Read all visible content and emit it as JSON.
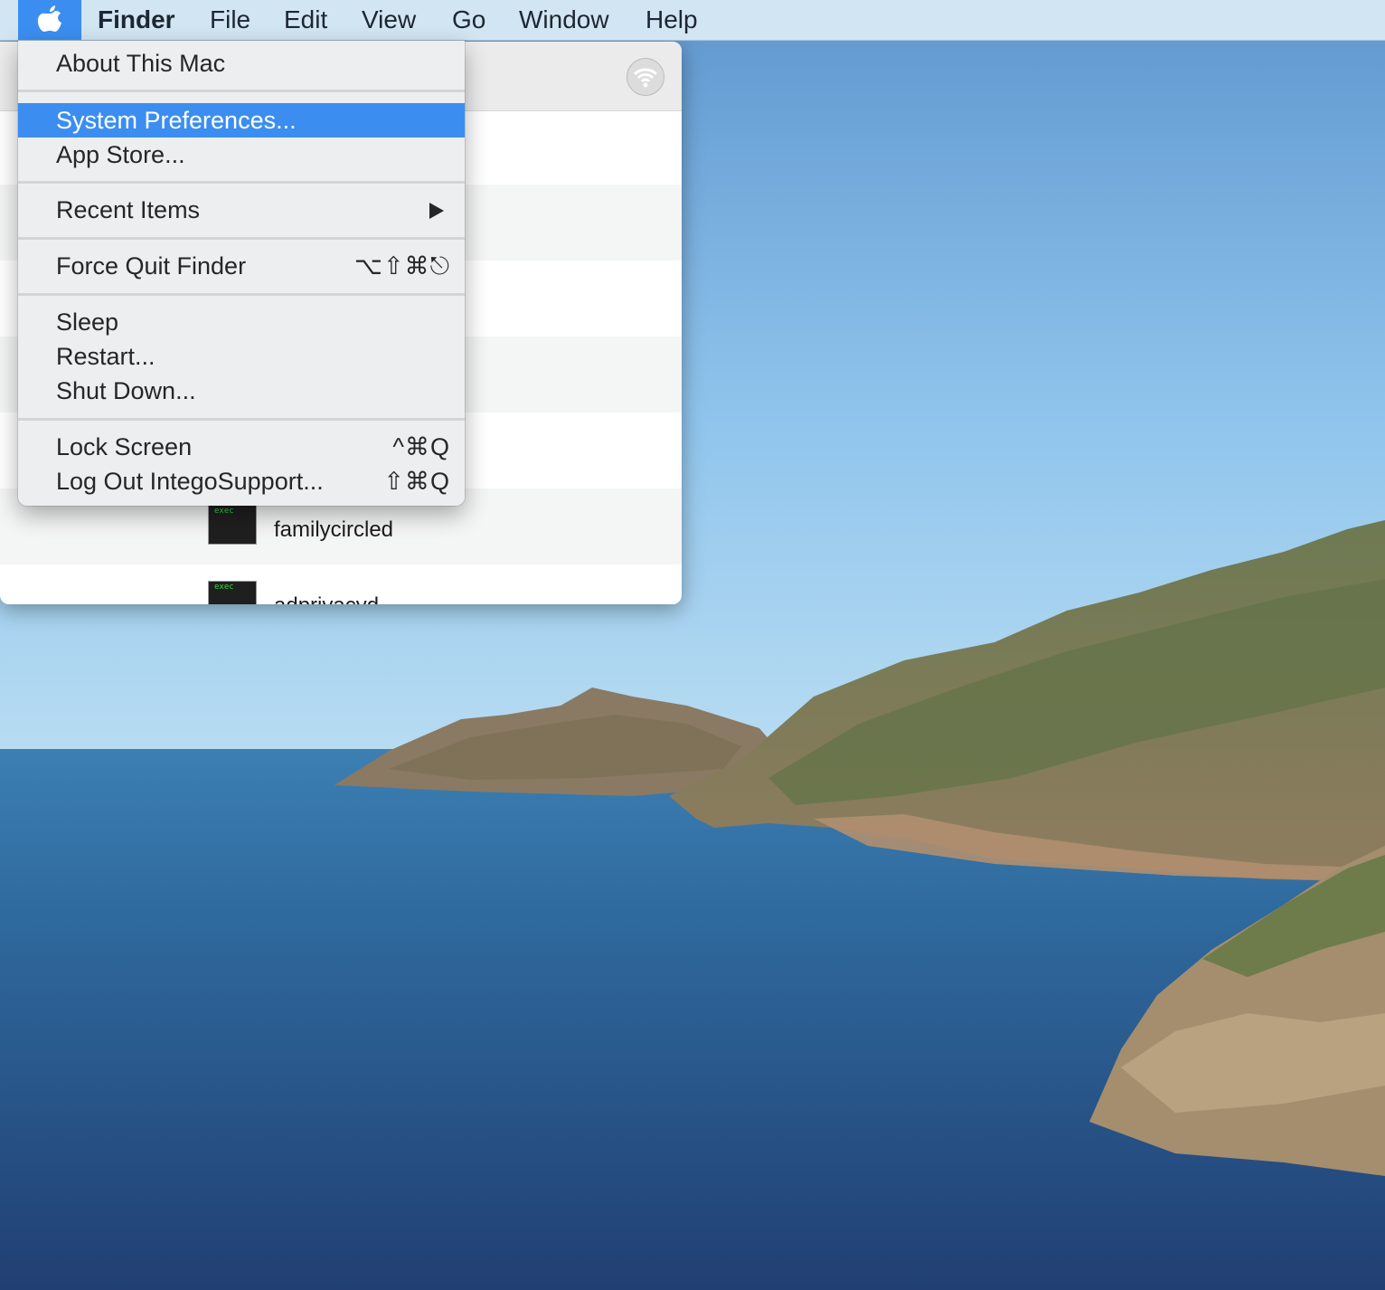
{
  "menubar": {
    "apple_icon": "apple-logo-icon",
    "app_name": "Finder",
    "items": [
      "File",
      "Edit",
      "View",
      "Go",
      "Window",
      "Help"
    ]
  },
  "apple_menu": {
    "about": "About This Mac",
    "system_preferences": "System Preferences...",
    "app_store": "App Store...",
    "recent_items": "Recent Items",
    "force_quit": "Force Quit Finder",
    "force_quit_shortcut": "⌥⇧⌘⎋",
    "sleep": "Sleep",
    "restart": "Restart...",
    "shut_down": "Shut Down...",
    "lock_screen": "Lock Screen",
    "lock_screen_shortcut": "^⌘Q",
    "log_out": "Log Out IntegoSupport...",
    "log_out_shortcut": "⇧⌘Q"
  },
  "finder_window": {
    "airdrop_icon": "airdrop-icon",
    "exec_tag": "exec",
    "rows": [
      "familycircled",
      "adprivacyd"
    ]
  },
  "colors": {
    "highlight": "#3b8ef0",
    "sky": "#8ec3ea",
    "sea": "#2a5d8f"
  }
}
